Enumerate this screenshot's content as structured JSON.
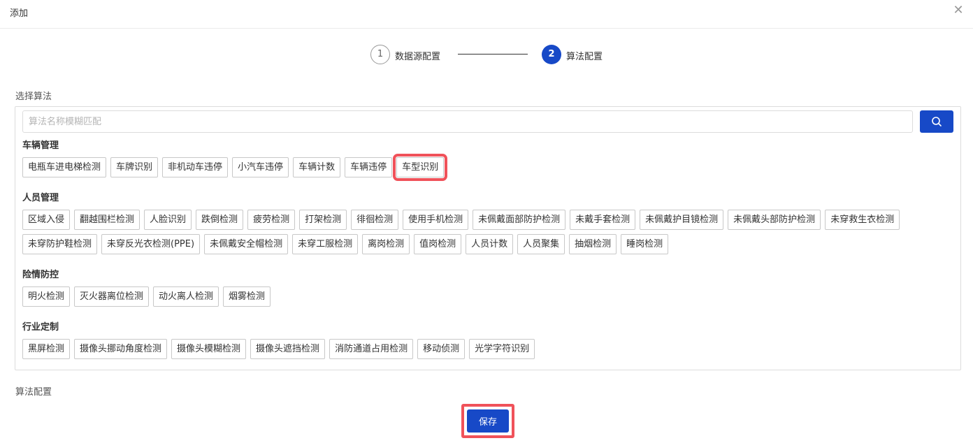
{
  "dialog": {
    "title": "添加",
    "close_icon": "close-icon"
  },
  "steps": [
    {
      "number": "1",
      "label": "数据源配置",
      "status": "done"
    },
    {
      "number": "2",
      "label": "算法配置",
      "status": "active"
    }
  ],
  "select_section": {
    "label": "选择算法",
    "search": {
      "placeholder": "算法名称模糊匹配",
      "value": "",
      "icon": "search-icon"
    },
    "groups": [
      {
        "title": "车辆管理",
        "items": [
          "电瓶车进电梯检测",
          "车牌识别",
          "非机动车违停",
          "小汽车违停",
          "车辆计数",
          "车辆违停",
          "车型识别"
        ],
        "highlighted": "车型识别"
      },
      {
        "title": "人员管理",
        "items": [
          "区域入侵",
          "翻越围栏检测",
          "人脸识别",
          "跌倒检测",
          "疲劳检测",
          "打架检测",
          "徘徊检测",
          "使用手机检测",
          "未佩戴面部防护检测",
          "未戴手套检测",
          "未佩戴护目镜检测",
          "未佩戴头部防护检测",
          "未穿救生衣检测",
          "未穿防护鞋检测",
          "未穿反光衣检测(PPE)",
          "未佩戴安全帽检测",
          "未穿工服检测",
          "离岗检测",
          "值岗检测",
          "人员计数",
          "人员聚集",
          "抽烟检测",
          "睡岗检测"
        ]
      },
      {
        "title": "险情防控",
        "items": [
          "明火检测",
          "灭火器离位检测",
          "动火离人检测",
          "烟雾检测"
        ]
      },
      {
        "title": "行业定制",
        "items": [
          "黑屏检测",
          "摄像头挪动角度检测",
          "摄像头模糊检测",
          "摄像头遮挡检测",
          "消防通道占用检测",
          "移动侦测",
          "光学字符识别"
        ]
      }
    ]
  },
  "config_section": {
    "label": "算法配置"
  },
  "footer": {
    "save_label": "保存"
  },
  "colors": {
    "primary": "#1749c7",
    "highlight": "#f0525a",
    "border": "#c8c8c8"
  }
}
